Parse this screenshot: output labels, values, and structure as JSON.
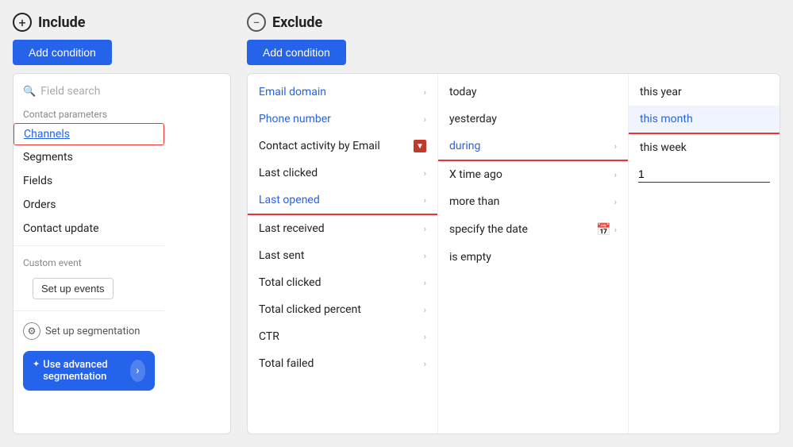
{
  "include": {
    "title": "Include",
    "add_button": "Add condition"
  },
  "exclude": {
    "title": "Exclude",
    "add_button": "Add condition"
  },
  "left_panel": {
    "search_placeholder": "Field search",
    "contact_params_label": "Contact parameters",
    "sidebar_items": [
      {
        "id": "channels",
        "label": "Channels",
        "highlighted": true
      },
      {
        "id": "segments",
        "label": "Segments"
      },
      {
        "id": "fields",
        "label": "Fields"
      },
      {
        "id": "orders",
        "label": "Orders"
      },
      {
        "id": "contact-update",
        "label": "Contact update"
      }
    ],
    "custom_event_label": "Custom event",
    "setup_events_btn": "Set up events",
    "setup_segmentation_label": "Set up segmentation",
    "advanced_seg_label": "Use advanced segmentation"
  },
  "fields_col": {
    "items": [
      {
        "id": "email-domain",
        "label": "Email domain",
        "blue": true,
        "chevron": true
      },
      {
        "id": "phone-number",
        "label": "Phone number",
        "blue": true,
        "chevron": true
      },
      {
        "id": "contact-activity-email",
        "label": "Contact activity by Email",
        "chevron": true,
        "has_icon": true
      },
      {
        "id": "last-clicked",
        "label": "Last clicked",
        "chevron": true
      },
      {
        "id": "last-opened",
        "label": "Last opened",
        "blue": true,
        "active_underline": true,
        "chevron": true
      },
      {
        "id": "last-received",
        "label": "Last received",
        "chevron": true
      },
      {
        "id": "last-sent",
        "label": "Last sent",
        "chevron": true
      },
      {
        "id": "total-clicked",
        "label": "Total clicked",
        "chevron": true
      },
      {
        "id": "total-clicked-percent",
        "label": "Total clicked percent",
        "chevron": true
      },
      {
        "id": "ctr",
        "label": "CTR",
        "chevron": true
      },
      {
        "id": "total-failed",
        "label": "Total failed",
        "chevron": true
      }
    ]
  },
  "options_col": {
    "items": [
      {
        "id": "today",
        "label": "today",
        "chevron": false
      },
      {
        "id": "yesterday",
        "label": "yesterday",
        "chevron": false
      },
      {
        "id": "during",
        "label": "during",
        "blue": true,
        "active_underline": true,
        "chevron": true
      },
      {
        "id": "x-time-ago",
        "label": "X time ago",
        "chevron": true
      },
      {
        "id": "more-than",
        "label": "more than",
        "chevron": true
      },
      {
        "id": "specify-date",
        "label": "specify the date",
        "calendar": true,
        "chevron": true
      },
      {
        "id": "is-empty",
        "label": "is empty",
        "chevron": false
      }
    ]
  },
  "values_col": {
    "items": [
      {
        "id": "this-year",
        "label": "this year"
      },
      {
        "id": "this-month",
        "label": "this month",
        "active": true
      },
      {
        "id": "this-week",
        "label": "this week"
      }
    ],
    "input_value": "1"
  }
}
